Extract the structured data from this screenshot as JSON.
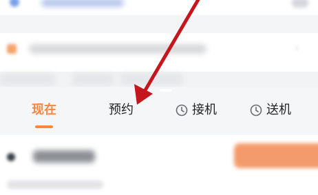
{
  "tabs": [
    {
      "label": "现在",
      "active": true,
      "icon": ""
    },
    {
      "label": "预约",
      "active": false,
      "icon": ""
    },
    {
      "label": "接机",
      "active": false,
      "icon": "clock-icon"
    },
    {
      "label": "送机",
      "active": false,
      "icon": "clock-icon"
    }
  ],
  "colors": {
    "accent": "#f5883f",
    "annotation_arrow": "#c4161c",
    "tab_text": "#222222"
  },
  "annotation": {
    "type": "arrow",
    "target": "预约"
  }
}
